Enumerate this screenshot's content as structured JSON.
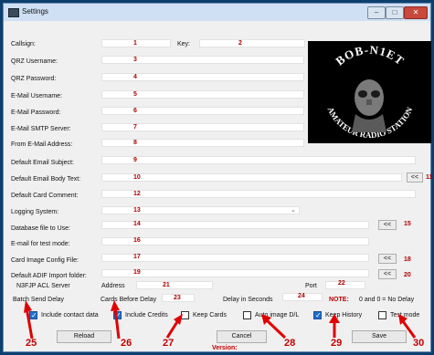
{
  "window": {
    "title": "Settings",
    "min_glyph": "–",
    "max_glyph": "□",
    "close_glyph": "✕"
  },
  "form": {
    "callsign": {
      "label": "Callsign:",
      "key_label": "Key:",
      "num": "1",
      "key_num": "2"
    },
    "qrz_username": {
      "label": "QRZ Username:",
      "num": "3"
    },
    "qrz_password": {
      "label": "QRZ Password:",
      "num": "4"
    },
    "email_username": {
      "label": "E-Mail Username:",
      "num": "5"
    },
    "email_password": {
      "label": "E-Mail Password:",
      "num": "6"
    },
    "email_smtp": {
      "label": "E-Mail SMTP Server:",
      "num": "7"
    },
    "from_email": {
      "label": "From E-Mail Address:",
      "num": "8"
    },
    "email_subject": {
      "label": "Default Email Subject:",
      "num": "9"
    },
    "email_body": {
      "label": "Default Email Body Text:",
      "num": "10",
      "btn": "<<",
      "btn_num": "11"
    },
    "card_comment": {
      "label": "Default Card Comment:",
      "num": "12"
    },
    "logging_system": {
      "label": "Logging System:",
      "num": "13"
    },
    "database_file": {
      "label": "Database file to Use:",
      "num": "14",
      "btn": "<<",
      "btn_num": "15"
    },
    "test_email": {
      "label": "E-mail for test mode:",
      "num": "16"
    },
    "card_image_config": {
      "label": "Card Image Config File:",
      "num": "17",
      "btn": "<<",
      "btn_num": "18"
    },
    "adif_folder": {
      "label": "Default ADIF Import folder:",
      "num": "19",
      "btn": "<<",
      "btn_num": "20"
    },
    "acl_server": {
      "label": "N3FJP ACL Server",
      "address_label": "Address",
      "address_num": "21",
      "port_label": "Port",
      "port_num": "22"
    },
    "batch": {
      "label": "Batch Send Delay",
      "cards_label": "Cards Before Delay",
      "cards_num": "23",
      "delay_label": "Delay in Seconds",
      "delay_num": "24",
      "note_label": "NOTE:",
      "note_text": "0 and 0 = No Delay"
    }
  },
  "options": [
    {
      "label": "Include contact data",
      "checked": true,
      "num": "25"
    },
    {
      "label": "Include Credits",
      "checked": true,
      "num": "26"
    },
    {
      "label": "Keep Cards",
      "checked": false,
      "num": "27"
    },
    {
      "label": "Auto image D/L",
      "checked": false,
      "num": "28"
    },
    {
      "label": "Keep History",
      "checked": true,
      "num": "29"
    },
    {
      "label": "Test mode",
      "checked": false,
      "num": "30"
    }
  ],
  "buttons": {
    "reload": "Reload",
    "cancel": "Cancel",
    "save": "Save"
  },
  "footer": {
    "version_label": "Version:"
  },
  "logo": {
    "top_text": "BOB-N1ET",
    "bottom_text": "AMATEUR RADIO STATION",
    "alt": "BOB-N1ET Amateur Radio Station logo"
  }
}
